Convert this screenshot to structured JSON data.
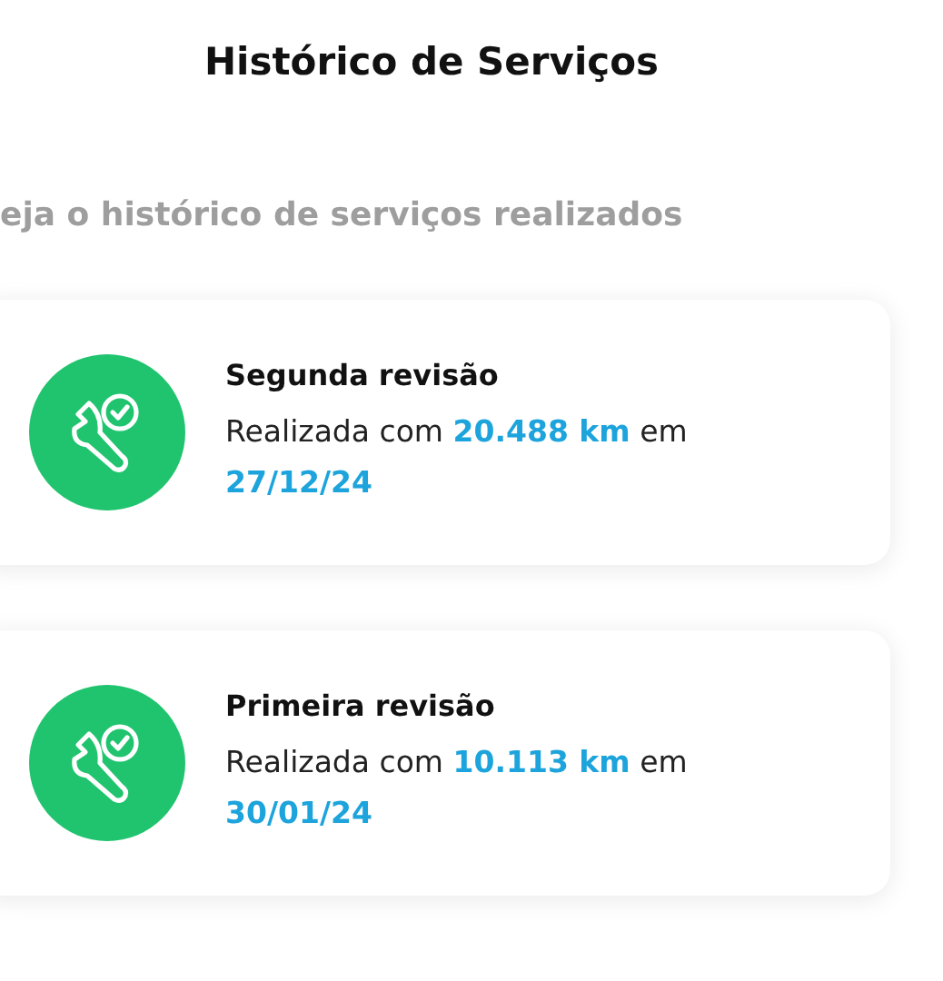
{
  "header": {
    "title": "Histórico de Serviços"
  },
  "subtitle": "eja o histórico de serviços realizados",
  "services": [
    {
      "title": "Segunda revisão",
      "detail": "Realizada com **20.488 km** em **27/12/24**"
    },
    {
      "title": "Primeira revisão",
      "detail": "Realizada com **10.113 km** em **30/01/24**"
    }
  ]
}
